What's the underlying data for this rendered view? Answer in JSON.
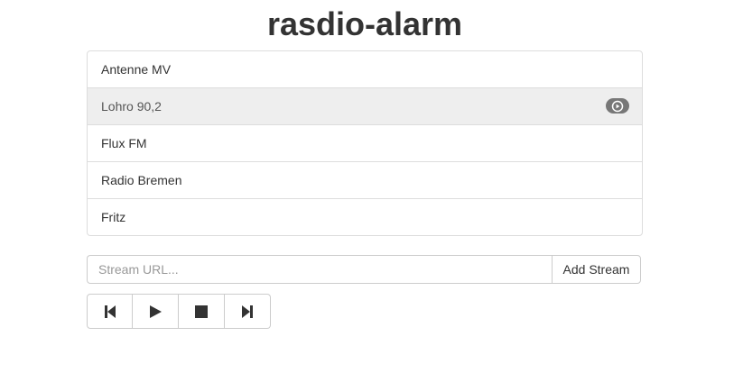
{
  "app": {
    "title": "rasdio-alarm"
  },
  "stations": [
    {
      "label": "Antenne MV",
      "active": false
    },
    {
      "label": "Lohro 90,2",
      "active": true
    },
    {
      "label": "Flux FM",
      "active": false
    },
    {
      "label": "Radio Bremen",
      "active": false
    },
    {
      "label": "Fritz",
      "active": false
    }
  ],
  "stream_form": {
    "url_value": "",
    "url_placeholder": "Stream URL...",
    "add_label": "Add Stream"
  },
  "player_controls": [
    {
      "name": "previous",
      "icon": "step-backward-icon"
    },
    {
      "name": "play",
      "icon": "play-icon"
    },
    {
      "name": "stop",
      "icon": "stop-icon"
    },
    {
      "name": "next",
      "icon": "step-forward-icon"
    }
  ],
  "colors": {
    "active_row": "#eeeeee",
    "badge": "#777777",
    "border": "#dddddd",
    "text": "#333333"
  }
}
